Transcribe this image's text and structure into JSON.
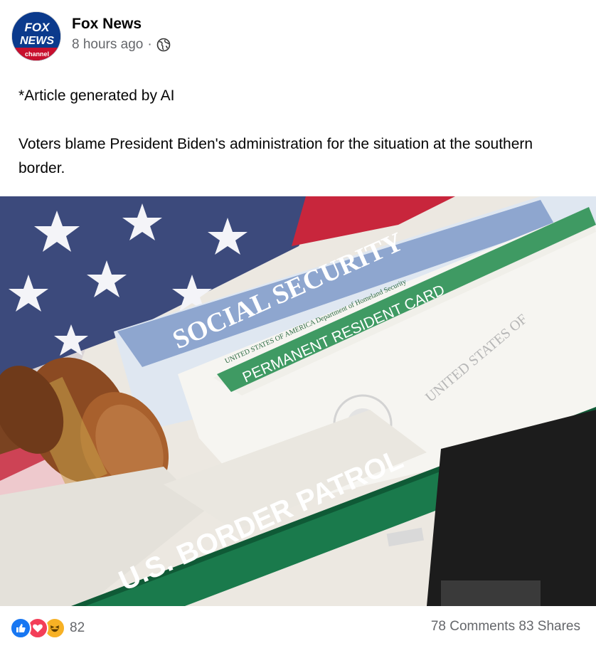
{
  "post": {
    "author": "Fox News",
    "avatar_logo": {
      "line1": "FOX",
      "line2": "NEWS",
      "line3": "channel"
    },
    "time": "8 hours ago",
    "separator": "·",
    "audience_icon": "globe-icon",
    "text_line1": "*Article generated by AI",
    "text_line2": "Voters blame President Biden's administration for the situation at the southern border.",
    "image": {
      "description_icon": "photo",
      "texts": {
        "social_security": "SOCIAL SECURITY",
        "united_states": "UNITED STATES OF AMERICA   Department of Homeland Security",
        "resident_card": "PERMANENT RESIDENT CARD",
        "states_of": "UNITED STATES OF",
        "border_patrol": "U.S. BORDER PATROL"
      }
    }
  },
  "footer": {
    "reaction_icons": [
      "like-icon",
      "love-icon",
      "haha-icon"
    ],
    "reaction_count": "82",
    "comments": "78 Comments",
    "shares": "83 Shares"
  },
  "colors": {
    "fox_blue": "#0b3a8c",
    "fox_red": "#c8102e",
    "like": "#1877f2",
    "love": "#f33e58",
    "haha": "#f7b125",
    "border_green": "#1a7a4c"
  }
}
